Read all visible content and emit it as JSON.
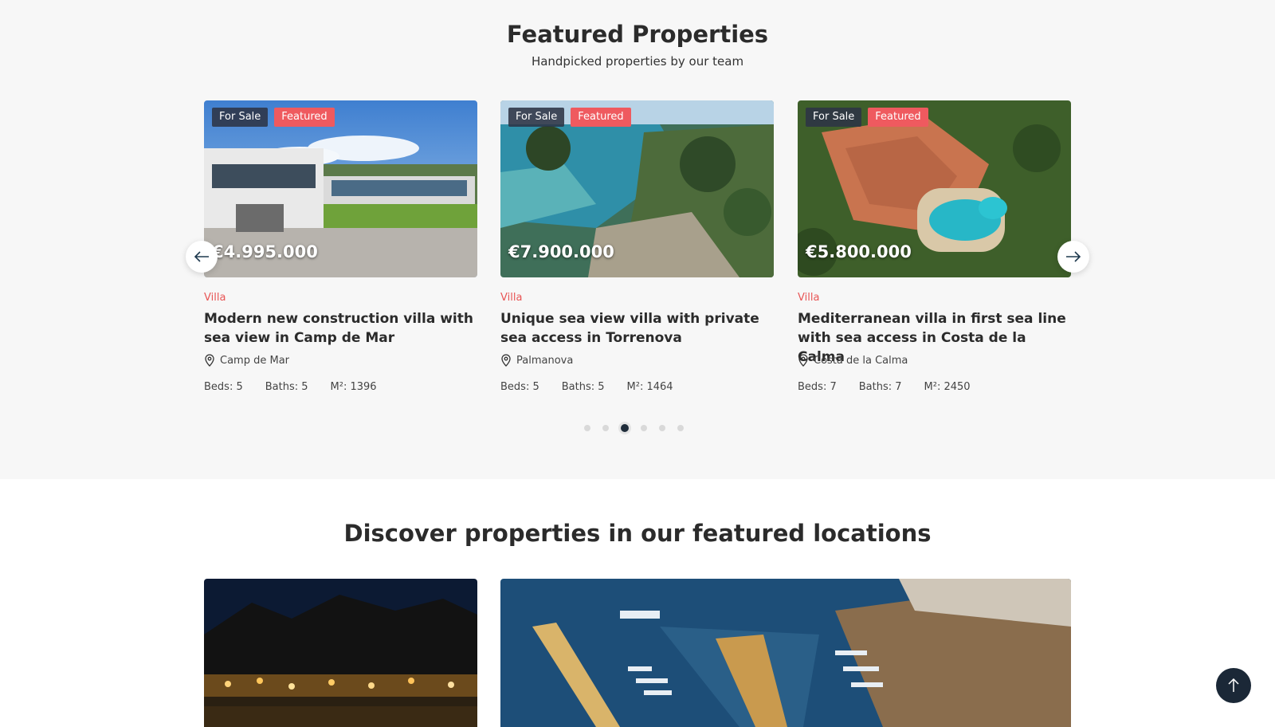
{
  "featured": {
    "title": "Featured Properties",
    "subtitle": "Handpicked properties by our team",
    "properties": [
      {
        "badge_sale": "For Sale",
        "badge_featured": "Featured",
        "price": "€4.995.000",
        "type": "Villa",
        "title": "Modern new construction villa with sea view in Camp de Mar",
        "location": "Camp de Mar",
        "beds": "Beds: 5",
        "baths": "Baths: 5",
        "area": "M²: 1396"
      },
      {
        "badge_sale": "For Sale",
        "badge_featured": "Featured",
        "price": "€7.900.000",
        "type": "Villa",
        "title": "Unique sea view villa with private sea access in Torrenova",
        "location": "Palmanova",
        "beds": "Beds: 5",
        "baths": "Baths: 5",
        "area": "M²: 1464"
      },
      {
        "badge_sale": "For Sale",
        "badge_featured": "Featured",
        "price": "€5.800.000",
        "type": "Villa",
        "title": "Mediterranean villa in first sea line with sea access in Costa de la Calma",
        "location": "Costa de la Calma",
        "beds": "Beds: 7",
        "baths": "Baths: 7",
        "area": "M²: 2450"
      }
    ],
    "carousel": {
      "page_count": 6,
      "active_page": 3
    }
  },
  "locations": {
    "title": "Discover properties in our featured locations"
  },
  "colors": {
    "accent": "#ef5a5f",
    "dark": "#1b2837",
    "section_bg": "#f7f7f7"
  },
  "icons": [
    "arrow-left-icon",
    "arrow-right-icon",
    "map-pin-icon",
    "arrow-up-icon"
  ]
}
